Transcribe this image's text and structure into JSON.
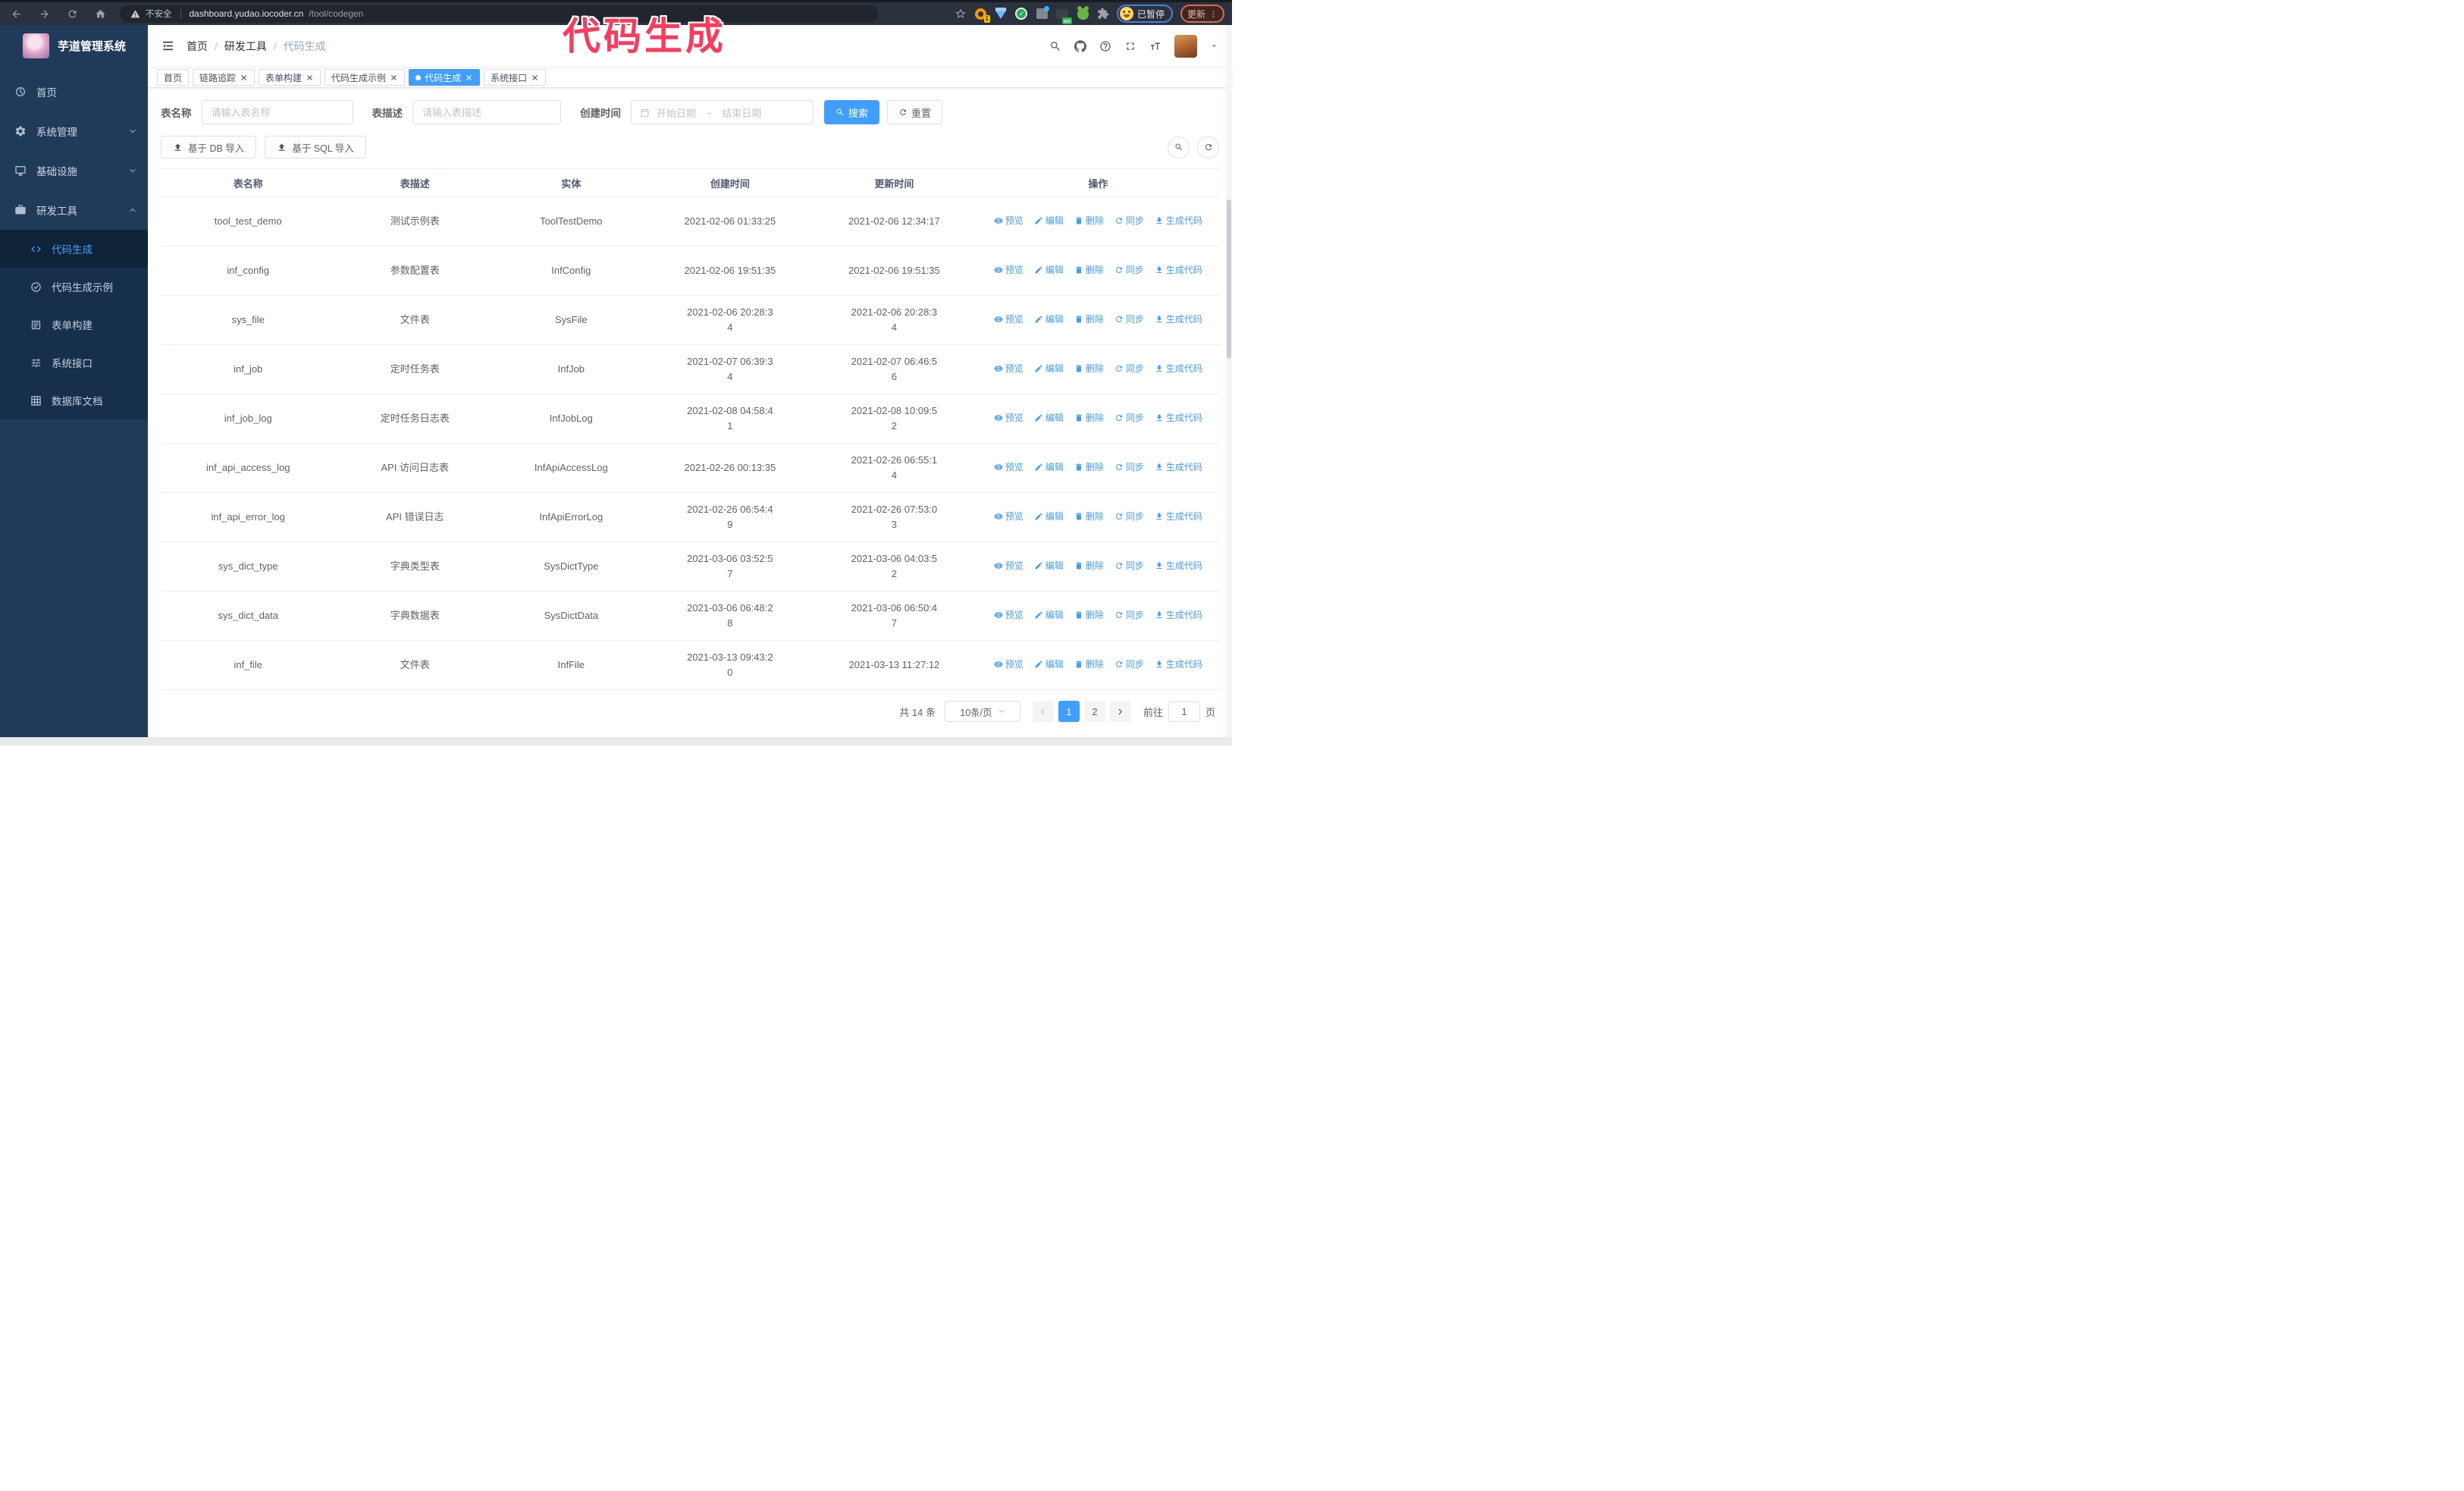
{
  "browser": {
    "security_label": "不安全",
    "url_host": "dashboard.yudao.iocoder.cn",
    "url_path": "/tool/codegen",
    "extension_badge": "1",
    "extension_on_badge": "on",
    "paused_badge": "已暂停",
    "update_button": "更新"
  },
  "annotation": {
    "text": "代码生成",
    "color": "#fb3b5e"
  },
  "sidebar": {
    "title": "芋道管理系统",
    "items": [
      {
        "label": "首页",
        "icon": "dashboard-icon"
      },
      {
        "label": "系统管理",
        "icon": "gear-icon"
      },
      {
        "label": "基础设施",
        "icon": "monitor-icon"
      },
      {
        "label": "研发工具",
        "icon": "toolbox-icon"
      }
    ],
    "submenu": [
      {
        "label": "代码生成",
        "icon": "code-icon",
        "active": true
      },
      {
        "label": "代码生成示例",
        "icon": "check-circle-icon"
      },
      {
        "label": "表单构建",
        "icon": "form-icon"
      },
      {
        "label": "系统接口",
        "icon": "sliders-icon"
      },
      {
        "label": "数据库文档",
        "icon": "grid-icon"
      }
    ]
  },
  "header": {
    "breadcrumb": [
      "首页",
      "研发工具",
      "代码生成"
    ],
    "separator": "/"
  },
  "tags": [
    {
      "label": "首页"
    },
    {
      "label": "链路追踪"
    },
    {
      "label": "表单构建"
    },
    {
      "label": "代码生成示例"
    },
    {
      "label": "代码生成",
      "active": true
    },
    {
      "label": "系统接口"
    }
  ],
  "filters": {
    "name_label": "表名称",
    "name_placeholder": "请输入表名称",
    "desc_label": "表描述",
    "desc_placeholder": "请输入表描述",
    "time_label": "创建时间",
    "start_placeholder": "开始日期",
    "range_separator": "-",
    "end_placeholder": "结束日期",
    "search_button": "搜索",
    "reset_button": "重置"
  },
  "toolbar": {
    "import_db": "基于 DB 导入",
    "import_sql": "基于 SQL 导入",
    "icons": [
      "import-icon",
      "search-toggle-icon",
      "refresh-icon"
    ]
  },
  "table": {
    "columns": [
      "表名称",
      "表描述",
      "实体",
      "创建时间",
      "更新时间",
      "操作"
    ],
    "actions": [
      "预览",
      "编辑",
      "删除",
      "同步",
      "生成代码"
    ],
    "action_icons": [
      "eye-icon",
      "edit-icon",
      "trash-icon",
      "sync-icon",
      "download-icon"
    ],
    "rows": [
      {
        "name": "tool_test_demo",
        "desc": "测试示例表",
        "entity": "ToolTestDemo",
        "created": "2021-02-06 01:33:25",
        "updated": "2021-02-06 12:34:17"
      },
      {
        "name": "inf_config",
        "desc": "参数配置表",
        "entity": "InfConfig",
        "created": "2021-02-06 19:51:35",
        "updated": "2021-02-06 19:51:35"
      },
      {
        "name": "sys_file",
        "desc": "文件表",
        "entity": "SysFile",
        "created": "2021-02-06 20:28:3\n4",
        "updated": "2021-02-06 20:28:3\n4"
      },
      {
        "name": "inf_job",
        "desc": "定时任务表",
        "entity": "InfJob",
        "created": "2021-02-07 06:39:3\n4",
        "updated": "2021-02-07 06:46:5\n6"
      },
      {
        "name": "inf_job_log",
        "desc": "定时任务日志表",
        "entity": "InfJobLog",
        "created": "2021-02-08 04:58:4\n1",
        "updated": "2021-02-08 10:09:5\n2"
      },
      {
        "name": "inf_api_access_log",
        "desc": "API 访问日志表",
        "entity": "InfApiAccessLog",
        "created": "2021-02-26 00:13:35",
        "updated": "2021-02-26 06:55:1\n4"
      },
      {
        "name": "inf_api_error_log",
        "desc": "API 错误日志",
        "entity": "InfApiErrorLog",
        "created": "2021-02-26 06:54:4\n9",
        "updated": "2021-02-26 07:53:0\n3"
      },
      {
        "name": "sys_dict_type",
        "desc": "字典类型表",
        "entity": "SysDictType",
        "created": "2021-03-06 03:52:5\n7",
        "updated": "2021-03-06 04:03:5\n2"
      },
      {
        "name": "sys_dict_data",
        "desc": "字典数据表",
        "entity": "SysDictData",
        "created": "2021-03-06 06:48:2\n8",
        "updated": "2021-03-06 06:50:4\n7"
      },
      {
        "name": "inf_file",
        "desc": "文件表",
        "entity": "InfFile",
        "created": "2021-03-13 09:43:2\n0",
        "updated": "2021-03-13 11:27:12"
      }
    ]
  },
  "pagination": {
    "total": "共 14 条",
    "page_size": "10条/页",
    "page_1": "1",
    "page_2": "2",
    "current": "1",
    "goto_label": "前往",
    "goto_value": "1",
    "page_label": "页"
  },
  "colors": {
    "accent": "#409eff",
    "sidebar_bg": "#1f3b59",
    "submenu_bg": "#16304b",
    "chrome_bg": "#2b313d",
    "annotation": "#fb3b5e"
  }
}
